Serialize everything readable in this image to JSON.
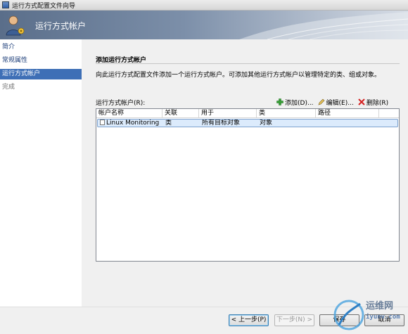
{
  "window": {
    "title": "运行方式配置文件向导"
  },
  "banner": {
    "title": "运行方式帐户"
  },
  "sidebar": {
    "items": [
      {
        "label": "简介",
        "state": "normal"
      },
      {
        "label": "常规属性",
        "state": "normal"
      },
      {
        "label": "运行方式帐户",
        "state": "active"
      },
      {
        "label": "完成",
        "state": "disabled"
      }
    ]
  },
  "main": {
    "section_title": "添加运行方式帐户",
    "description": "向此运行方式配置文件添加一个运行方式帐户。可添加其他运行方式帐户以管理特定的类、组或对象。",
    "list_label": "运行方式帐户(R):",
    "toolbar": {
      "add_label": "添加(D)...",
      "edit_label": "编辑(E)...",
      "delete_label": "删除(R)"
    },
    "table": {
      "columns": [
        "帐户名称",
        "关联",
        "用于",
        "类",
        "路径"
      ],
      "rows": [
        [
          "Linux Monitoring",
          "类",
          "所有目标对象",
          "对象",
          ""
        ]
      ]
    }
  },
  "footer": {
    "prev_label": "< 上一步(P)",
    "next_label": "下一步(N) >",
    "save_label": "保存",
    "cancel_label": "取消"
  },
  "watermark": {
    "cn": "运维网",
    "en": "iyunv.com"
  },
  "colors": {
    "accent": "#3e6fb6",
    "banner": "#5a6e8a",
    "row_highlight": "#dcebfc"
  },
  "icons": {
    "add": "green-plus-icon",
    "edit": "pencil-icon",
    "delete": "red-x-icon",
    "account": "user-key-icon"
  }
}
